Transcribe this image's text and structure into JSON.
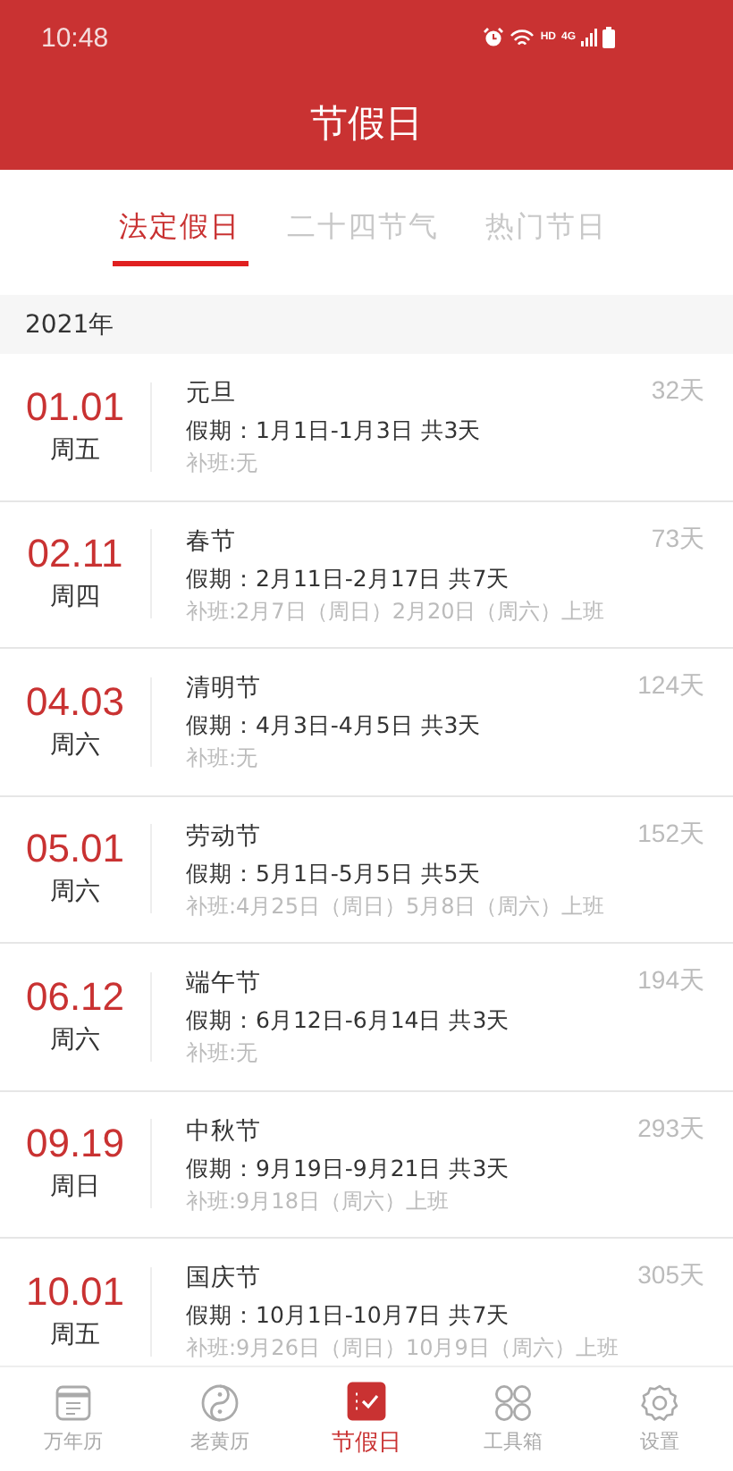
{
  "status_bar": {
    "time": "10:48",
    "hd": "HD",
    "network": "4G"
  },
  "header": {
    "title": "节假日"
  },
  "tabs": [
    {
      "label": "法定假日",
      "selected": true
    },
    {
      "label": "二十四节气",
      "selected": false
    },
    {
      "label": "热门节日",
      "selected": false
    }
  ],
  "year": "2021年",
  "holidays": [
    {
      "date": "01.01",
      "weekday": "周五",
      "name": "元旦",
      "period": "假期：1月1日-1月3日 共3天",
      "makeup": "补班:无",
      "countdown": "32天"
    },
    {
      "date": "02.11",
      "weekday": "周四",
      "name": "春节",
      "period": "假期：2月11日-2月17日 共7天",
      "makeup": "补班:2月7日（周日）2月20日（周六）上班",
      "countdown": "73天"
    },
    {
      "date": "04.03",
      "weekday": "周六",
      "name": "清明节",
      "period": "假期：4月3日-4月5日 共3天",
      "makeup": "补班:无",
      "countdown": "124天"
    },
    {
      "date": "05.01",
      "weekday": "周六",
      "name": "劳动节",
      "period": "假期：5月1日-5月5日 共5天",
      "makeup": "补班:4月25日（周日）5月8日（周六）上班",
      "countdown": "152天"
    },
    {
      "date": "06.12",
      "weekday": "周六",
      "name": "端午节",
      "period": "假期：6月12日-6月14日 共3天",
      "makeup": "补班:无",
      "countdown": "194天"
    },
    {
      "date": "09.19",
      "weekday": "周日",
      "name": "中秋节",
      "period": "假期：9月19日-9月21日 共3天",
      "makeup": "补班:9月18日（周六）上班",
      "countdown": "293天"
    },
    {
      "date": "10.01",
      "weekday": "周五",
      "name": "国庆节",
      "period": "假期：10月1日-10月7日 共7天",
      "makeup": "补班:9月26日（周日）10月9日（周六）上班",
      "countdown": "305天"
    }
  ],
  "bottom_nav": [
    {
      "kind": "calendar",
      "label": "万年历",
      "selected": false
    },
    {
      "kind": "yinyang",
      "label": "老黄历",
      "selected": false
    },
    {
      "kind": "holiday",
      "label": "节假日",
      "selected": true
    },
    {
      "kind": "tools",
      "label": "工具箱",
      "selected": false
    },
    {
      "kind": "settings",
      "label": "设置",
      "selected": false
    }
  ]
}
